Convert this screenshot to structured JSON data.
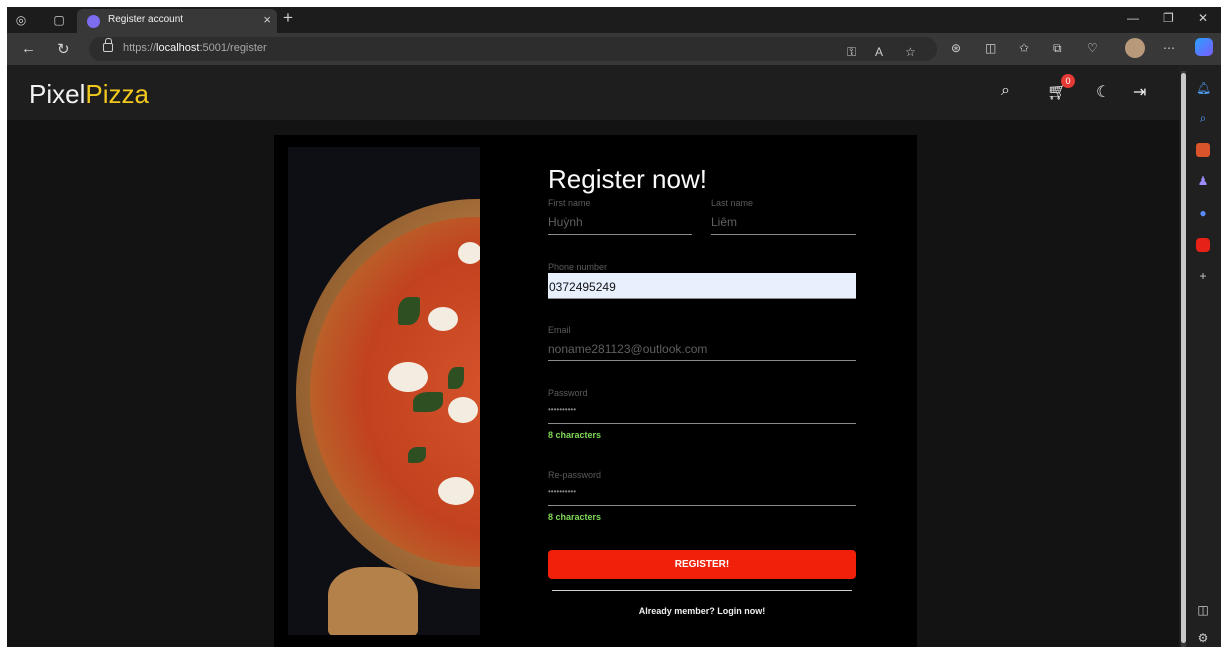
{
  "browser": {
    "tab_title": "Register account",
    "url_prefix": "https://",
    "url_host": "localhost",
    "url_rest": ":5001/register"
  },
  "site": {
    "logo_part1": "Pixel",
    "logo_part2": "Pizza",
    "cart_count": "0",
    "accent_color": "#f2c81e"
  },
  "form": {
    "title": "Register now!",
    "first_name_label": "First name",
    "first_name_value": "Huỳnh",
    "last_name_label": "Last name",
    "last_name_value": "Liêm",
    "phone_label": "Phone number",
    "phone_value": "0372495249",
    "email_label": "Email",
    "email_value": "noname281123@outlook.com",
    "password_label": "Password",
    "password_value": "••••••••••",
    "password_hint": "8 characters",
    "repassword_label": "Re-password",
    "repassword_value": "••••••••••",
    "repassword_hint": "8 characters",
    "register_button": "REGISTER!",
    "login_link": "Already member? Login now!"
  }
}
